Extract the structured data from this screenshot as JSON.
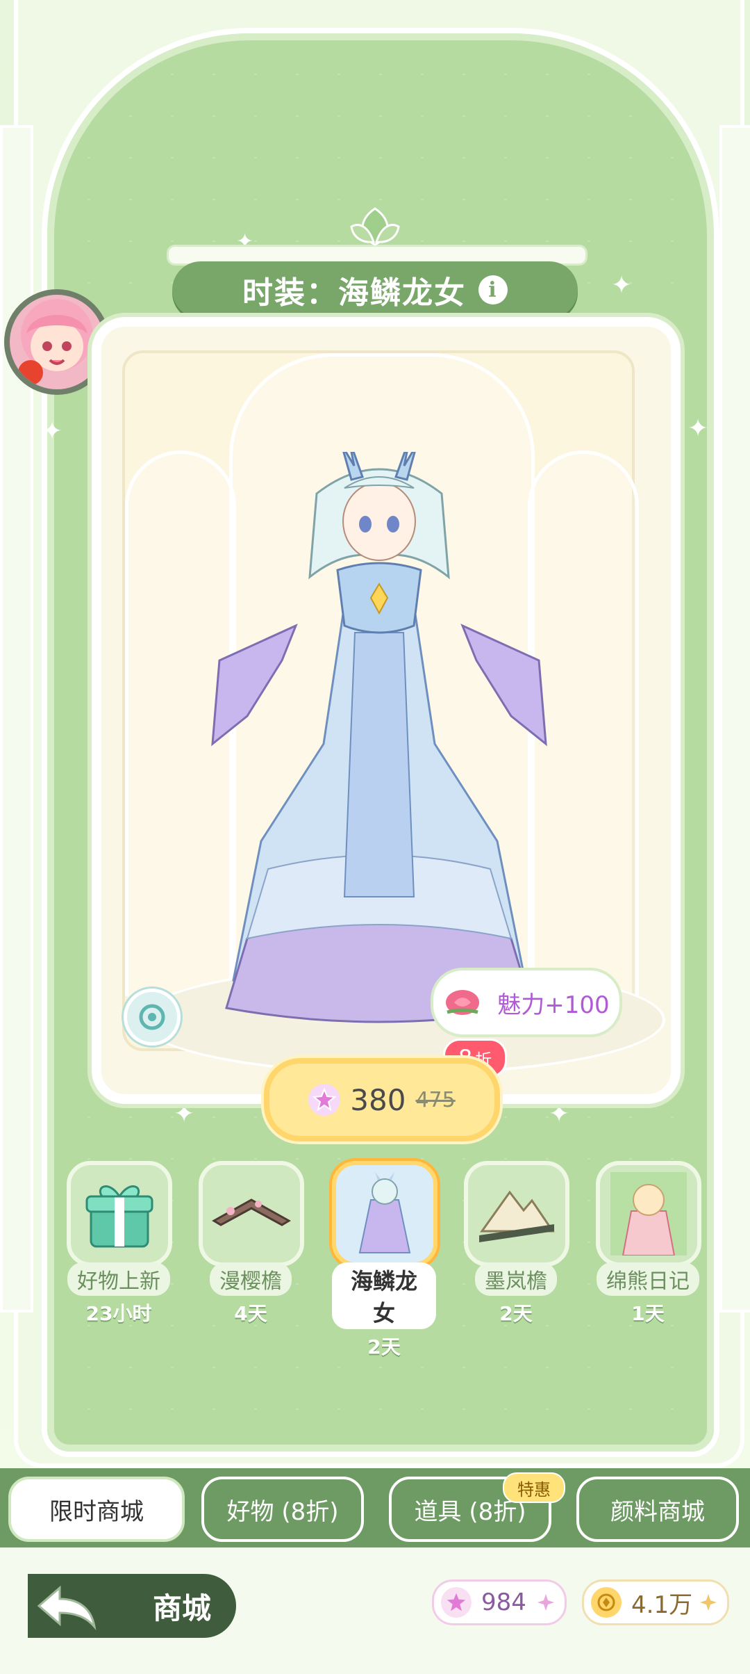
{
  "title": {
    "label": "时装：海鳞龙女"
  },
  "charm": {
    "label": "魅力+100"
  },
  "price": {
    "current": "380",
    "original": "475",
    "discount_value": "8",
    "discount_unit": "折"
  },
  "items": [
    {
      "name": "好物上新",
      "time": "23小时",
      "selected": false
    },
    {
      "name": "漫樱檐",
      "time": "4天",
      "selected": false
    },
    {
      "name": "海鳞龙女",
      "time": "2天",
      "selected": true
    },
    {
      "name": "墨岚檐",
      "time": "2天",
      "selected": false
    },
    {
      "name": "绵熊日记",
      "time": "1天",
      "selected": false
    }
  ],
  "tabs": [
    {
      "label": "限时商城",
      "active": true
    },
    {
      "label": "好物 (8折)",
      "active": false
    },
    {
      "label": "道具 (8折)",
      "active": false
    },
    {
      "label": "颜料商城",
      "active": false
    }
  ],
  "special_badge": "特惠",
  "back": {
    "label": "商城"
  },
  "currencies": [
    {
      "icon": "star-gem-icon",
      "value": "984"
    },
    {
      "icon": "gold-coin-icon",
      "value": "4.1万"
    }
  ],
  "colors": {
    "accent_green": "#78a769",
    "tab_green": "#6e9a63",
    "price_yellow": "#ffe898",
    "discount_red": "#ff5a6e",
    "charm_purple": "#b05ad6"
  }
}
